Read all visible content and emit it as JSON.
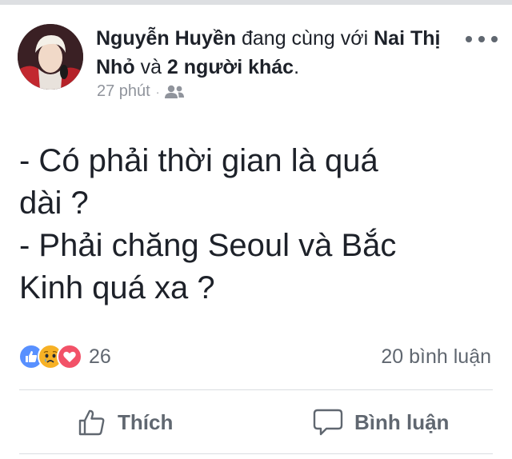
{
  "post": {
    "author": "Nguyễn Huyền",
    "with_text": "đang cùng với",
    "tagged_name": "Nai Thị Nhỏ",
    "and_text": "và",
    "others": "2 người khác",
    "period": ".",
    "timestamp": "27 phút",
    "separator": "·",
    "privacy_icon": "friends-icon",
    "body_lines": [
      "- Có phải thời gian là quá",
      "dài ?",
      "- Phải chăng Seoul và Bắc",
      "Kinh quá xa ?"
    ]
  },
  "stats": {
    "reaction_icons": [
      "like-icon",
      "sad-icon",
      "love-icon"
    ],
    "reaction_count": "26",
    "comment_count": "20 bình luận"
  },
  "actions": {
    "like_label": "Thích",
    "comment_label": "Bình luận"
  },
  "colors": {
    "text": "#1d2129",
    "secondary": "#90949c",
    "action": "#606770",
    "like_blue": "#5890ff",
    "sad_yellow": "#f7b125",
    "love_red": "#f25268"
  }
}
